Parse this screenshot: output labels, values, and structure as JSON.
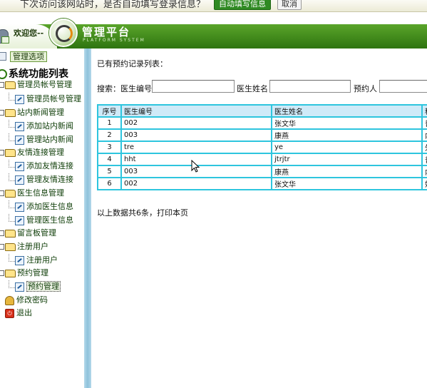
{
  "notification": {
    "message": "下次访问该网站时，是否自动填写登录信息？",
    "fill_button": "自动填写信息",
    "cancel_button": "取消"
  },
  "header": {
    "welcome": "欢迎您--",
    "title": "管理平台",
    "subtitle": "PLATFORM SYSTEM"
  },
  "sidebar": {
    "panel_tab": "管理选项",
    "root": "系统功能列表",
    "tree": [
      {
        "label": "管理员帐号管理",
        "children": [
          "管理员帐号管理"
        ]
      },
      {
        "label": "站内新闻管理",
        "children": [
          "添加站内新闻",
          "管理站内新闻"
        ]
      },
      {
        "label": "友情连接管理",
        "children": [
          "添加友情连接",
          "管理友情连接"
        ]
      },
      {
        "label": "医生信息管理",
        "children": [
          "添加医生信息",
          "管理医生信息"
        ]
      },
      {
        "label": "留言板管理",
        "children": []
      },
      {
        "label": "注册用户",
        "children": [
          "注册用户"
        ]
      },
      {
        "label": "预约管理",
        "children": [
          "预约管理"
        ]
      }
    ],
    "change_password": "修改密码",
    "logout": "退出"
  },
  "main": {
    "list_title": "已有预约记录列表：",
    "search": {
      "label": "搜索：医生编号：",
      "doctor_name_label": "医生姓名",
      "booker_label": "预约人",
      "doctor_no_value": "",
      "doctor_name_value": "",
      "booker_value": ""
    },
    "table": {
      "columns": [
        "序号",
        "医生编号",
        "医生姓名",
        "科"
      ],
      "rows": [
        [
          "1",
          "002",
          "张文华",
          "普"
        ],
        [
          "2",
          "003",
          "康燕",
          "内"
        ],
        [
          "3",
          "tre",
          "ye",
          "外"
        ],
        [
          "4",
          "hht",
          "jtrjtr",
          "普"
        ],
        [
          "5",
          "003",
          "康燕",
          "内"
        ],
        [
          "6",
          "002",
          "张文华",
          "妇"
        ]
      ]
    },
    "footer": "以上数据共6条，打印本页"
  }
}
